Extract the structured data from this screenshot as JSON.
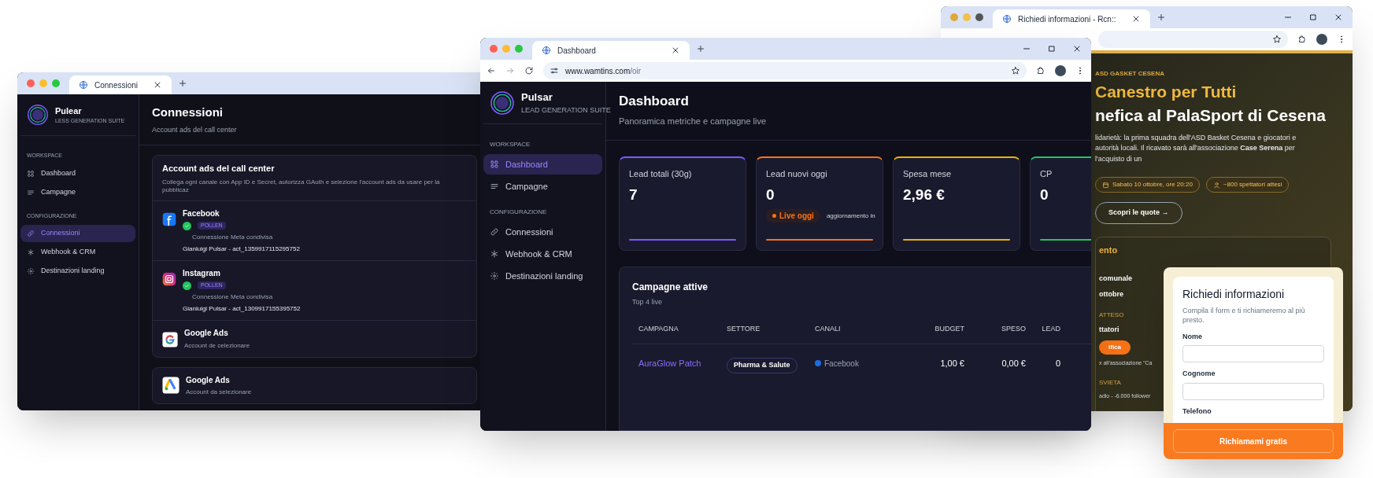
{
  "left_window": {
    "tab_title": "Connessioni",
    "brand": {
      "name": "Pulear",
      "tagline": "LESS GENERATION SUITE"
    },
    "nav": [
      {
        "kind": "section",
        "label": "WORKSPACE"
      },
      {
        "kind": "item",
        "label": "Dashboard",
        "selected": false
      },
      {
        "kind": "item",
        "label": "Campagne",
        "selected": false
      },
      {
        "kind": "section",
        "label": "CONFIGURAZIONE"
      },
      {
        "kind": "item",
        "label": "Connessioni",
        "selected": true
      },
      {
        "kind": "item",
        "label": "Webhook & CRM",
        "selected": false
      },
      {
        "kind": "item",
        "label": "Destinazioni landing",
        "selected": false
      }
    ],
    "page": {
      "title": "Connessioni",
      "subtitle": "Account ads del call center"
    },
    "card": {
      "title": "Account ads del call center",
      "description": "Collega ogni canale con App ID e Secret, autorizza GAuth e selezione l'account ads da usare per la pubblicaz",
      "accounts": [
        {
          "kind": "facebook",
          "name": "Facebook",
          "connected": true,
          "badge": "POLLEN",
          "note": "Connessione Meta condivisa",
          "account": "Gianluigi Pulsar - act_1359917115295752"
        },
        {
          "kind": "instagram",
          "name": "Instagram",
          "connected": true,
          "badge": "POLLEN",
          "note": "Connessione Meta condivisa",
          "account": "Gianluigi Pulsar - act_1309917155395752"
        },
        {
          "kind": "google",
          "name": "Google Ads",
          "connected": false,
          "note": "Account de celezionare"
        }
      ]
    },
    "extra_cards": [
      {
        "kind": "google_ads",
        "name": "Google Ads",
        "note": "Account da selezionare"
      }
    ]
  },
  "center_window": {
    "tab_title": "Dashboard",
    "url_host": "www.wamtins.com",
    "url_path": "/oir",
    "brand": {
      "name": "Pulsar",
      "tagline": "LEAD GENERATION SUITE"
    },
    "nav": [
      {
        "kind": "section",
        "label": "WORKSPACE"
      },
      {
        "kind": "item",
        "label": "Dashboard",
        "selected": true
      },
      {
        "kind": "item",
        "label": "Campagne",
        "selected": false
      },
      {
        "kind": "section",
        "label": "CONFIGURAZIONE"
      },
      {
        "kind": "item",
        "label": "Connessioni",
        "selected": false
      },
      {
        "kind": "item",
        "label": "Webhook & CRM",
        "selected": false
      },
      {
        "kind": "item",
        "label": "Destinazioni landing",
        "selected": false
      }
    ],
    "page": {
      "title": "Dashboard",
      "subtitle": "Panoramica metriche e campagne live"
    },
    "stats": [
      {
        "label": "Lead totali (30g)",
        "value": "7",
        "color": "#7c5cff"
      },
      {
        "label": "Lead nuovi oggi",
        "value": "0",
        "color": "#f97316",
        "live_badge": "Live oggi",
        "note": "aggiornamento in"
      },
      {
        "label": "Spesa mese",
        "value": "2,96 €",
        "color": "#eab308"
      },
      {
        "label": "CP",
        "value": "0",
        "color": "#22c55e"
      }
    ],
    "table": {
      "title": "Campagne attive",
      "subtitle": "Top 4 live",
      "columns": [
        "CAMPAGNA",
        "SETTORE",
        "CANALI",
        "BUDGET",
        "SPESO",
        "LEAD"
      ],
      "rows": [
        {
          "campaign": "AuraGlow Patch",
          "sector": "Pharma & Salute",
          "channel": {
            "name": "Facebook",
            "color": "#1d6ce0"
          },
          "budget": "1,00 €",
          "spent": "0,00 €",
          "leads": "0"
        }
      ]
    }
  },
  "right_window": {
    "tab_title": "Richiedi informazioni - Rcn::",
    "eyebrow": "ASD GASKET CESENA",
    "headline_accent": "Canestro per Tutti",
    "headline": "nefica al PalaSport di Cesena",
    "paragraph": "lidarietà: la prima squadra dell'ASD Basket Cesena e giocatori e autorità locali. Il ricavato sarà all'associazione **Case Serena** per l'acquisto di un",
    "chips": [
      "Sabato 10 ottobre, ore 20:20",
      "~800 spettatori attesi"
    ],
    "cta": "Scopri le quote →",
    "details": {
      "title": "ento",
      "rows": [
        {
          "kind": "value",
          "text": "comunale"
        },
        {
          "kind": "value",
          "text": "ottobre"
        },
        {
          "kind": "label",
          "text": "ATTESO"
        },
        {
          "kind": "value",
          "text": "ttatori"
        },
        {
          "kind": "pill",
          "text": "ifica"
        },
        {
          "kind": "note",
          "text": "x all'associazione “Ca"
        },
        {
          "kind": "label",
          "text": "SVIETA"
        },
        {
          "kind": "note",
          "text": "adio - -6.000 follower"
        }
      ]
    }
  },
  "form": {
    "title": "Richiedi informazioni",
    "description": "Compila il form e ti richiameremo al più presto.",
    "fields": [
      {
        "kind": "input",
        "label": "Nome"
      },
      {
        "kind": "input",
        "label": "Cognome"
      },
      {
        "kind": "label_only",
        "label": "Telefono"
      }
    ],
    "submit": "Richiamami gratis"
  }
}
